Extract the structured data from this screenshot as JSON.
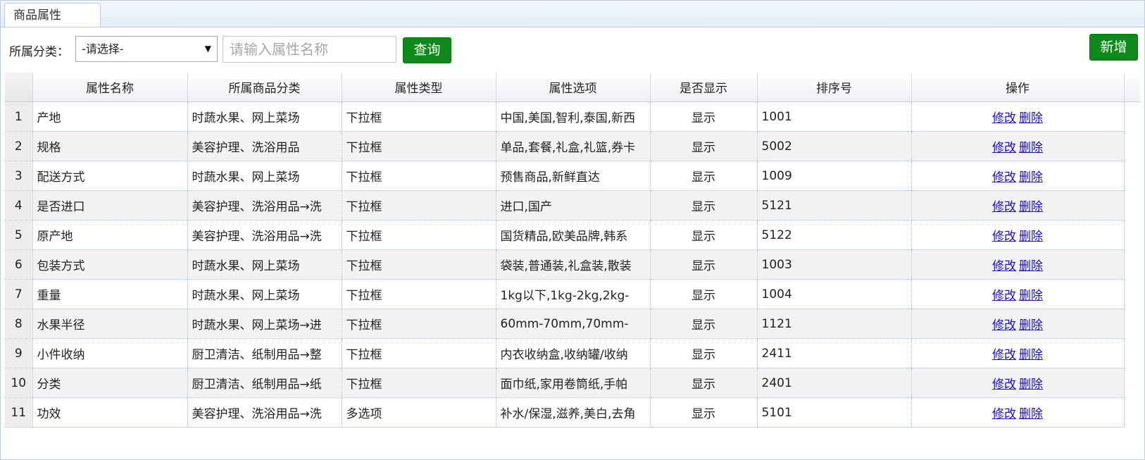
{
  "tab": {
    "label": "商品属性"
  },
  "toolbar": {
    "category_label": "所属分类：",
    "category_selected": "-请选择-",
    "search_placeholder": "请输入属性名称",
    "query_label": "查询",
    "add_label": "新增"
  },
  "table": {
    "headers": [
      "属性名称",
      "所属商品分类",
      "属性类型",
      "属性选项",
      "是否显示",
      "排序号",
      "操作"
    ],
    "edit_label": "修改",
    "delete_label": "删除",
    "rows": [
      {
        "num": "1",
        "name": "产地",
        "category": "时蔬水果、网上菜场",
        "type": "下拉框",
        "options": "中国,美国,智利,泰国,新西",
        "display": "显示",
        "sort": "1001"
      },
      {
        "num": "2",
        "name": "规格",
        "category": "美容护理、洗浴用品",
        "type": "下拉框",
        "options": "单品,套餐,礼盒,礼篮,券卡",
        "display": "显示",
        "sort": "5002"
      },
      {
        "num": "3",
        "name": "配送方式",
        "category": "时蔬水果、网上菜场",
        "type": "下拉框",
        "options": "预售商品,新鲜直达",
        "display": "显示",
        "sort": "1009"
      },
      {
        "num": "4",
        "name": "是否进口",
        "category": "美容护理、洗浴用品→洗",
        "type": "下拉框",
        "options": "进口,国产",
        "display": "显示",
        "sort": "5121"
      },
      {
        "num": "5",
        "name": "原产地",
        "category": "美容护理、洗浴用品→洗",
        "type": "下拉框",
        "options": "国货精品,欧美品牌,韩系",
        "display": "显示",
        "sort": "5122"
      },
      {
        "num": "6",
        "name": "包装方式",
        "category": "时蔬水果、网上菜场",
        "type": "下拉框",
        "options": "袋装,普通装,礼盒装,散装",
        "display": "显示",
        "sort": "1003"
      },
      {
        "num": "7",
        "name": "重量",
        "category": "时蔬水果、网上菜场",
        "type": "下拉框",
        "options": "1kg以下,1kg-2kg,2kg-",
        "display": "显示",
        "sort": "1004"
      },
      {
        "num": "8",
        "name": "水果半径",
        "category": "时蔬水果、网上菜场→进",
        "type": "下拉框",
        "options": "60mm-70mm,70mm-",
        "display": "显示",
        "sort": "1121"
      },
      {
        "num": "9",
        "name": "小件收纳",
        "category": "厨卫清洁、纸制用品→整",
        "type": "下拉框",
        "options": "内衣收纳盒,收纳罐/收纳",
        "display": "显示",
        "sort": "2411"
      },
      {
        "num": "10",
        "name": "分类",
        "category": "厨卫清洁、纸制用品→纸",
        "type": "下拉框",
        "options": "面巾纸,家用卷筒纸,手帕",
        "display": "显示",
        "sort": "2401"
      },
      {
        "num": "11",
        "name": "功效",
        "category": "美容护理、洗浴用品→洗",
        "type": "多选项",
        "options": "补水/保湿,滋养,美白,去角",
        "display": "显示",
        "sort": "5101"
      }
    ]
  }
}
